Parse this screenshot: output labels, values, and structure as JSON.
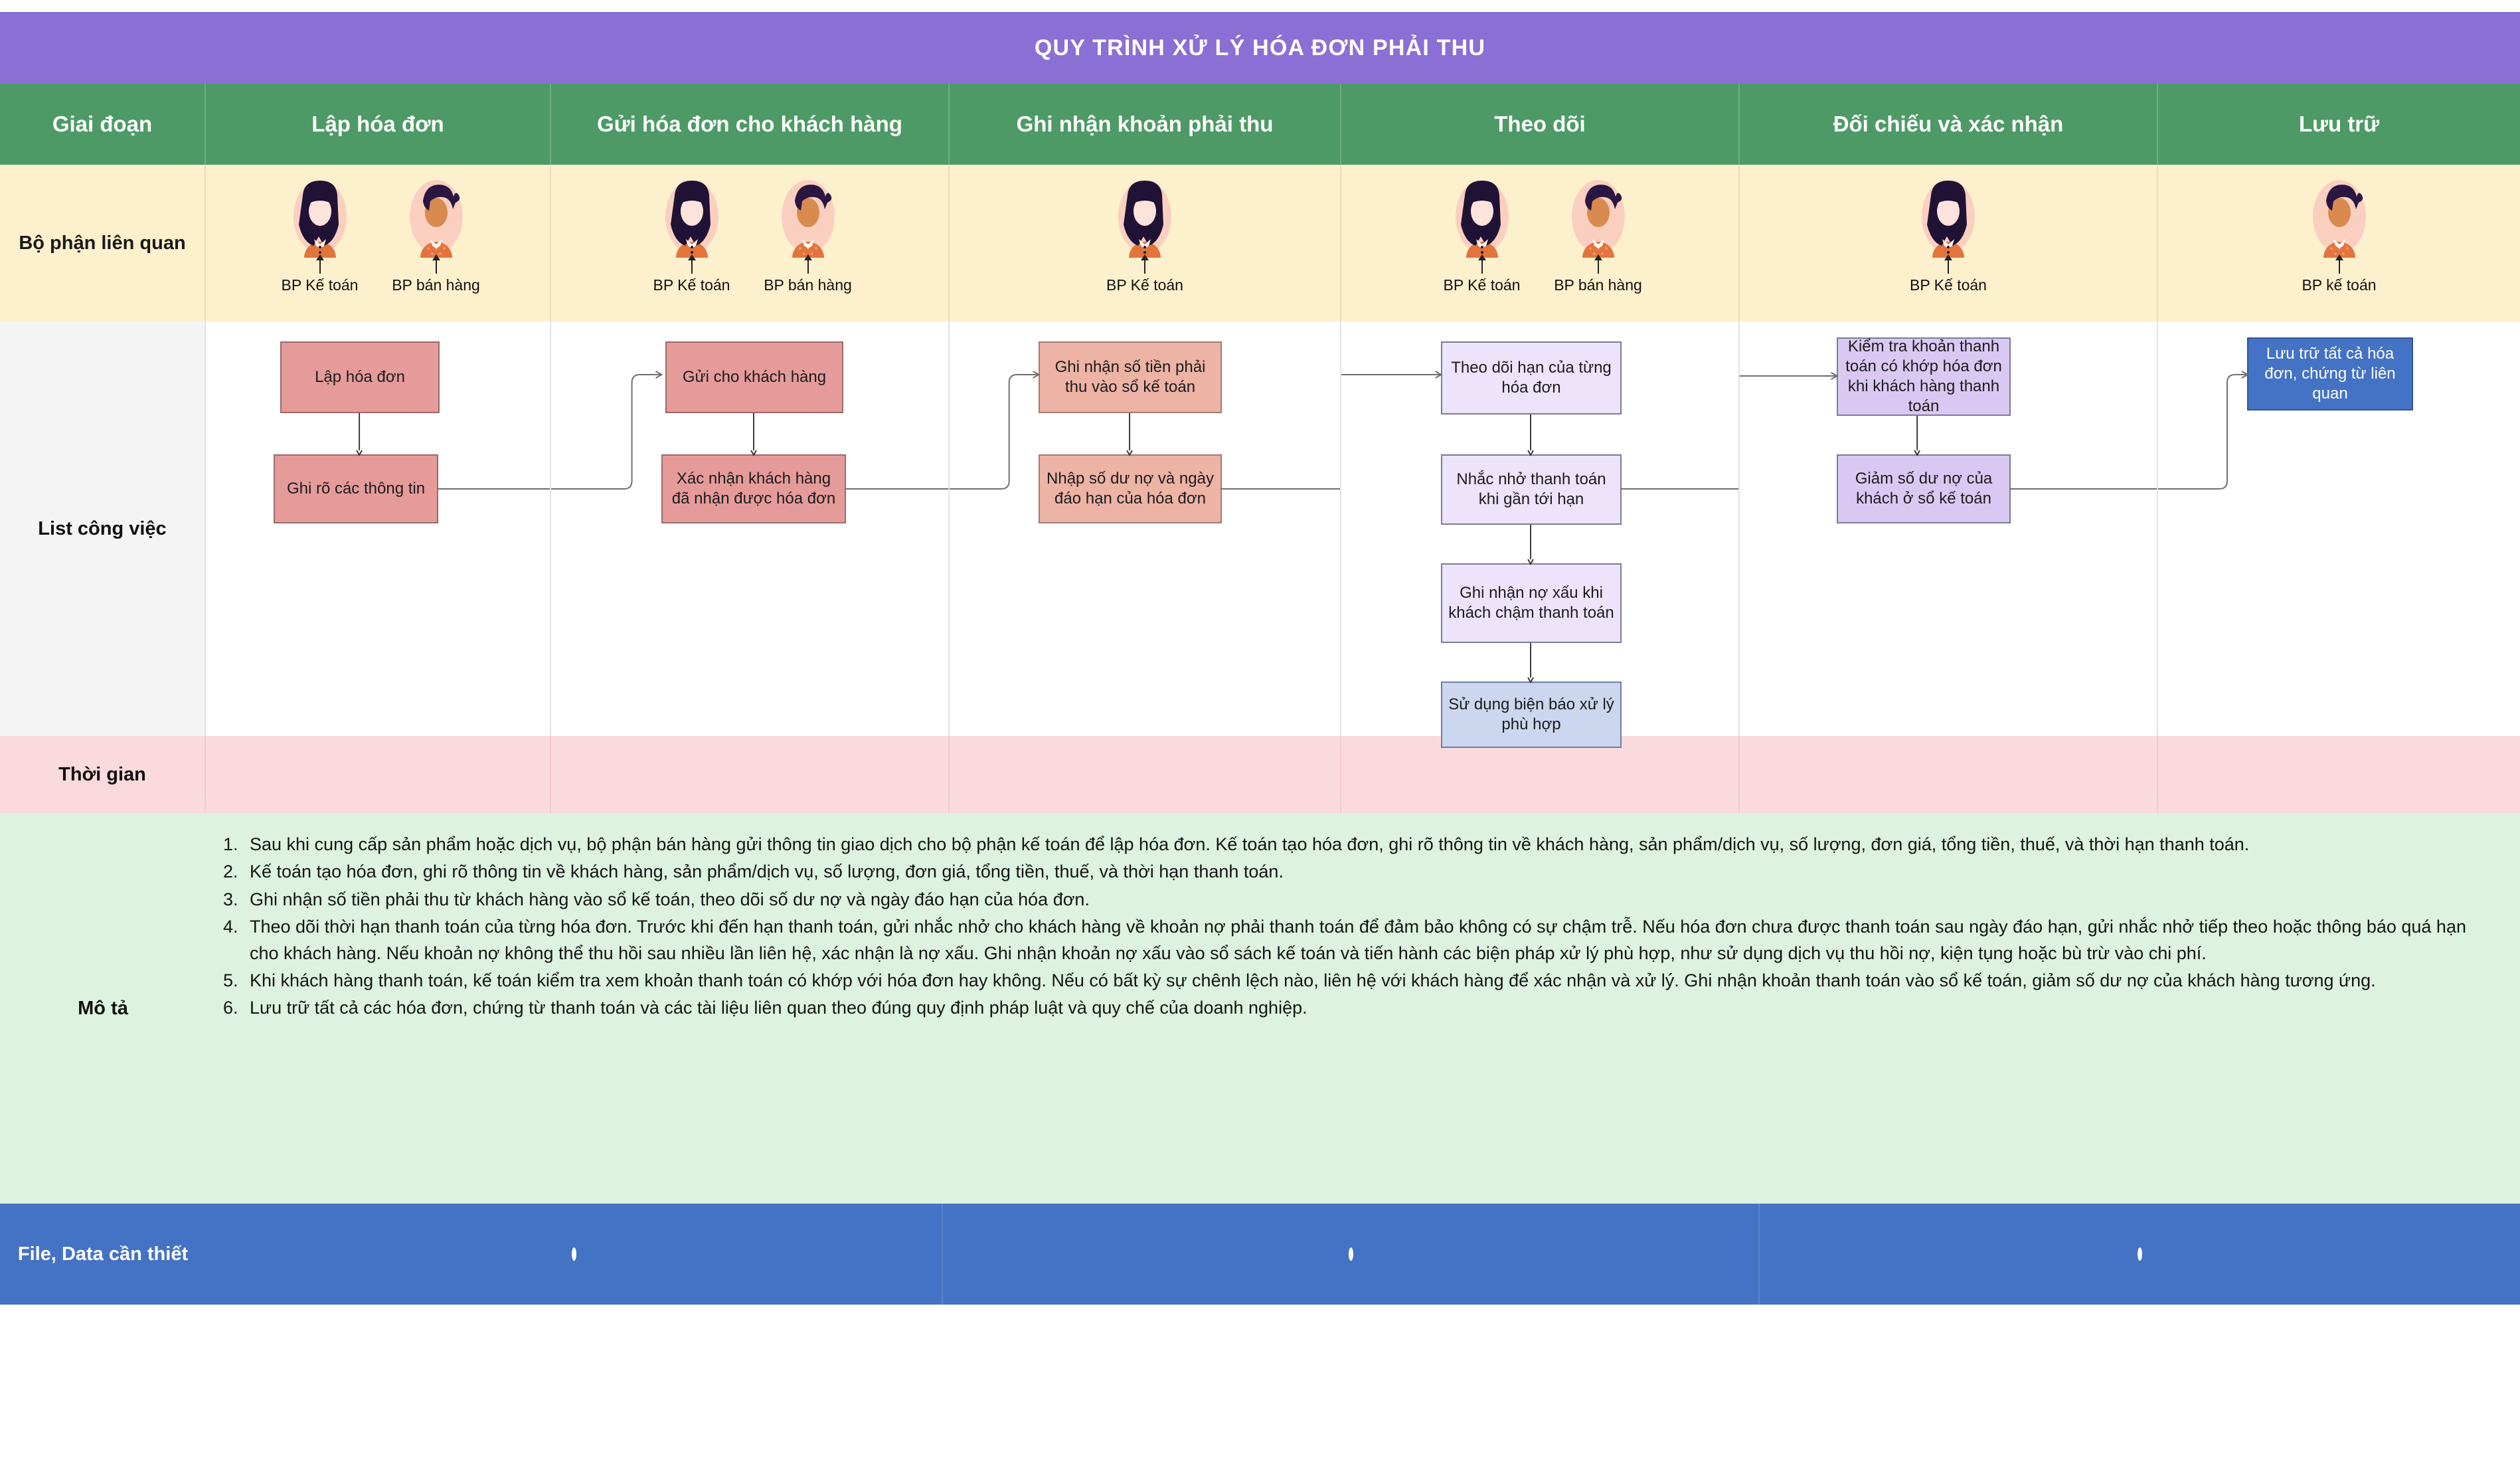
{
  "title": "QUY TRÌNH XỬ LÝ HÓA ĐƠN PHẢI THU",
  "colors": {
    "title_bg": "#8a6fd4",
    "header_bg": "#4e9a66",
    "dept_bg": "#fdf0cd",
    "work_bg": "#f4f4f4",
    "time_bg": "#fbdadd",
    "desc_bg": "#ddf2e1",
    "file_bg": "#4472c4",
    "node_red": "#e69b9b",
    "node_salmon": "#edb3a5",
    "node_purple": "#ede4fb",
    "node_purple_dark": "#d9c9f2",
    "node_blue_light": "#ccd6ef",
    "node_blue": "#4472c4"
  },
  "row_labels": {
    "stage": "Giai đoạn",
    "departments": "Bộ phận liên quan",
    "worklist": "List công việc",
    "time": "Thời gian",
    "description": "Mô tả",
    "files": "File, Data cần thiết"
  },
  "stages": [
    {
      "label": "Lập hóa đơn"
    },
    {
      "label": "Gửi hóa đơn cho khách hàng"
    },
    {
      "label": "Ghi nhận khoản phải thu"
    },
    {
      "label": "Theo dõi"
    },
    {
      "label": "Đối chiếu và xác nhận"
    },
    {
      "label": "Lưu trữ"
    }
  ],
  "departments": [
    {
      "people": [
        {
          "label": "BP Kế toán",
          "avatar": "woman-long-hair-avatar"
        },
        {
          "label": "BP bán hàng",
          "avatar": "woman-ponytail-avatar"
        }
      ]
    },
    {
      "people": [
        {
          "label": "BP Kế toán",
          "avatar": "woman-long-hair-avatar"
        },
        {
          "label": "BP bán hàng",
          "avatar": "woman-ponytail-avatar"
        }
      ]
    },
    {
      "people": [
        {
          "label": "BP Kế toán",
          "avatar": "woman-long-hair-avatar"
        }
      ]
    },
    {
      "people": [
        {
          "label": "BP Kế toán",
          "avatar": "woman-long-hair-avatar"
        },
        {
          "label": "BP bán hàng",
          "avatar": "woman-ponytail-avatar"
        }
      ]
    },
    {
      "people": [
        {
          "label": "BP Kế toán",
          "avatar": "woman-long-hair-avatar"
        }
      ]
    },
    {
      "people": [
        {
          "label": "BP kế toán",
          "avatar": "woman-ponytail-avatar"
        }
      ]
    }
  ],
  "worklist": {
    "col1": [
      "Lập hóa đơn",
      "Ghi rõ các thông tin"
    ],
    "col2": [
      "Gửi cho khách hàng",
      "Xác nhận khách hàng đã nhận được hóa đơn"
    ],
    "col3": [
      "Ghi nhận số tiền phải thu vào sổ kế toán",
      "Nhập số dư nợ và ngày đáo hạn của hóa đơn"
    ],
    "col4": [
      "Theo dõi hạn của từng hóa đơn",
      "Nhắc nhở thanh toán khi gần tới hạn",
      "Ghi nhận nợ xấu khi khách chậm thanh toán",
      "Sử dụng biện báo xử lý phù hợp"
    ],
    "col5": [
      "Kiểm tra khoản thanh toán có khớp hóa đơn khi khách hàng thanh toán",
      "Giảm số dư nợ của khách ở sổ kế toán"
    ],
    "col6": [
      "Lưu trữ tất cả hóa đơn, chứng từ liên quan"
    ]
  },
  "description_items": [
    "Sau khi cung cấp sản phẩm hoặc dịch vụ, bộ phận bán hàng gửi thông tin giao dịch cho bộ phận kế toán để lập hóa đơn. Kế toán tạo hóa đơn, ghi rõ thông tin về khách hàng, sản phẩm/dịch vụ, số lượng, đơn giá, tổng tiền, thuế, và thời hạn thanh toán.",
    "Kế toán tạo hóa đơn, ghi rõ thông tin về khách hàng, sản phẩm/dịch vụ, số lượng, đơn giá, tổng tiền, thuế, và thời hạn thanh toán.",
    "Ghi nhận số tiền phải thu từ khách hàng vào sổ kế toán, theo dõi số dư nợ và ngày đáo hạn của hóa đơn.",
    "Theo dõi thời hạn thanh toán của từng hóa đơn. Trước khi đến hạn thanh toán, gửi nhắc nhở cho khách hàng về khoản nợ phải thanh toán để đảm bảo không có sự chậm trễ. Nếu hóa đơn chưa được thanh toán sau ngày đáo hạn, gửi nhắc nhở tiếp theo hoặc thông báo quá hạn cho khách hàng. Nếu khoản nợ không thể thu hồi sau nhiều lần liên hệ, xác nhận là nợ xấu. Ghi nhận khoản nợ xấu vào sổ sách kế toán và tiến hành các biện pháp xử lý phù hợp, như sử dụng dịch vụ thu hồi nợ, kiện tụng hoặc bù trừ vào chi phí.",
    "Khi khách hàng thanh toán, kế toán kiểm tra xem khoản thanh toán có khớp với hóa đơn hay không. Nếu có bất kỳ sự chênh lệch nào, liên hệ với khách hàng để xác nhận và xử lý. Ghi nhận khoản thanh toán vào sổ kế toán, giảm số dư nợ của khách hàng tương ứng.",
    "Lưu trữ tất cả các hóa đơn, chứng từ thanh toán và các tài liệu liên quan theo đúng quy định pháp luật và quy chế của doanh nghiệp."
  ],
  "file_markers": [
    "•",
    "•",
    "•"
  ]
}
